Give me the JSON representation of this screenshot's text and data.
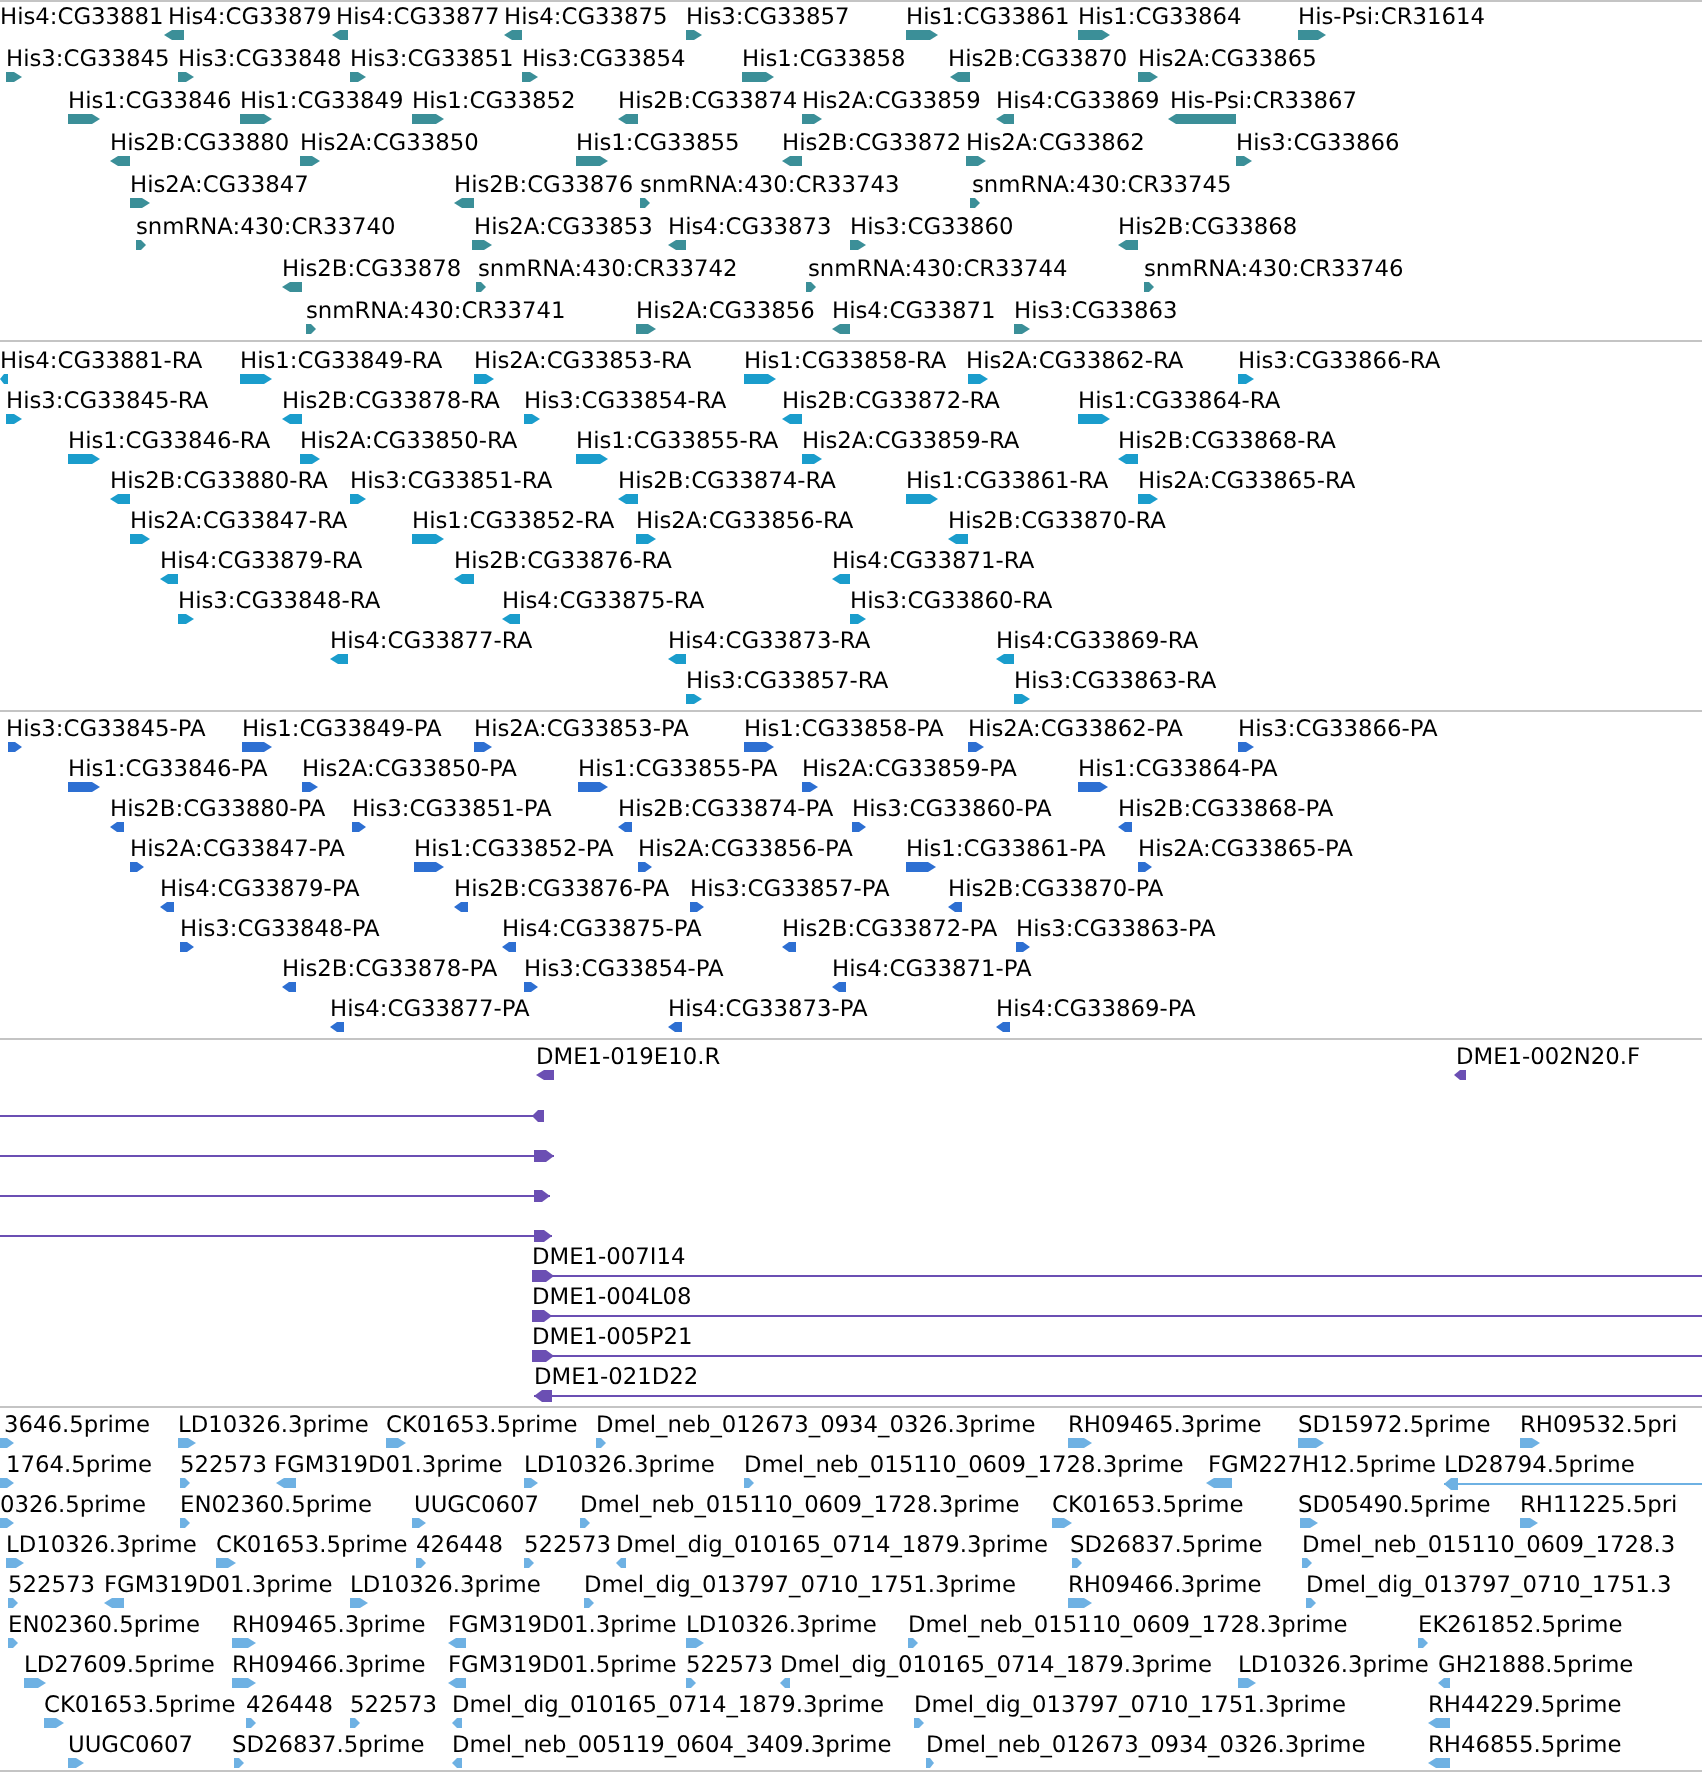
{
  "tracks": [
    {
      "color": "#3b8f98",
      "features": [
        {
          "label": "His4:CG33881"
        },
        {
          "label": "His4:CG33879",
          "reverse": true
        },
        {
          "label": "His4:CG33877",
          "reverse": true
        },
        {
          "label": "His4:CG33875",
          "reverse": true
        },
        {
          "label": "His3:CG33857",
          "reverse": false
        },
        {
          "label": "His1:CG33861",
          "reverse": false
        },
        {
          "label": "His1:CG33864",
          "reverse": false
        },
        {
          "label": "His-Psi:CR31614",
          "reverse": false
        },
        {
          "label": "His3:CG33845",
          "reverse": false
        },
        {
          "label": "His3:CG33848",
          "reverse": false
        },
        {
          "label": "His3:CG33851",
          "reverse": false
        },
        {
          "label": "His3:CG33854",
          "reverse": false
        },
        {
          "label": "His1:CG33858",
          "reverse": false
        },
        {
          "label": "His2B:CG33870",
          "reverse": true
        },
        {
          "label": "His2A:CG33865",
          "reverse": false
        },
        {
          "label": "His1:CG33846",
          "reverse": false
        },
        {
          "label": "His1:CG33849",
          "reverse": false
        },
        {
          "label": "His1:CG33852",
          "reverse": false
        },
        {
          "label": "His2B:CG33874",
          "reverse": true
        },
        {
          "label": "His2A:CG33859",
          "reverse": false
        },
        {
          "label": "His4:CG33869",
          "reverse": true
        },
        {
          "label": "His-Psi:CR33867",
          "reverse": true
        },
        {
          "label": "His2B:CG33880",
          "reverse": true
        },
        {
          "label": "His2A:CG33850",
          "reverse": false
        },
        {
          "label": "His1:CG33855",
          "reverse": false
        },
        {
          "label": "His2B:CG33872",
          "reverse": true
        },
        {
          "label": "His2A:CG33862",
          "reverse": false
        },
        {
          "label": "His3:CG33866",
          "reverse": false
        },
        {
          "label": "His2A:CG33847",
          "reverse": false
        },
        {
          "label": "His2B:CG33876",
          "reverse": true
        },
        {
          "label": "snmRNA:430:CR33743",
          "reverse": false
        },
        {
          "label": "snmRNA:430:CR33745",
          "reverse": false
        },
        {
          "label": "snmRNA:430:CR33740",
          "reverse": false
        },
        {
          "label": "His2A:CG33853",
          "reverse": false
        },
        {
          "label": "His4:CG33873",
          "reverse": true
        },
        {
          "label": "His3:CG33860",
          "reverse": false
        },
        {
          "label": "His2B:CG33868",
          "reverse": true
        },
        {
          "label": "His2B:CG33878",
          "reverse": true
        },
        {
          "label": "snmRNA:430:CR33742",
          "reverse": false
        },
        {
          "label": "snmRNA:430:CR33744",
          "reverse": false
        },
        {
          "label": "snmRNA:430:CR33746",
          "reverse": false
        },
        {
          "label": "snmRNA:430:CR33741",
          "reverse": false
        },
        {
          "label": "His2A:CG33856",
          "reverse": false
        },
        {
          "label": "His4:CG33871",
          "reverse": true
        },
        {
          "label": "His3:CG33863",
          "reverse": false
        }
      ]
    },
    {
      "color": "#1a9dcc",
      "features": [
        {
          "label": "His4:CG33881-RA",
          "reverse": true
        },
        {
          "label": "His1:CG33849-RA",
          "reverse": false
        },
        {
          "label": "His2A:CG33853-RA",
          "reverse": false
        },
        {
          "label": "His1:CG33858-RA",
          "reverse": false
        },
        {
          "label": "His2A:CG33862-RA",
          "reverse": false
        },
        {
          "label": "His3:CG33866-RA",
          "reverse": false
        },
        {
          "label": "His3:CG33845-RA",
          "reverse": false
        },
        {
          "label": "His2B:CG33878-RA",
          "reverse": true
        },
        {
          "label": "His3:CG33854-RA",
          "reverse": false
        },
        {
          "label": "His2B:CG33872-RA",
          "reverse": true
        },
        {
          "label": "His1:CG33864-RA",
          "reverse": false
        },
        {
          "label": "His1:CG33846-RA",
          "reverse": false
        },
        {
          "label": "His2A:CG33850-RA",
          "reverse": false
        },
        {
          "label": "His1:CG33855-RA",
          "reverse": false
        },
        {
          "label": "His2A:CG33859-RA",
          "reverse": false
        },
        {
          "label": "His2B:CG33868-RA",
          "reverse": true
        },
        {
          "label": "His2B:CG33880-RA",
          "reverse": true
        },
        {
          "label": "His3:CG33851-RA",
          "reverse": false
        },
        {
          "label": "His2B:CG33874-RA",
          "reverse": true
        },
        {
          "label": "His1:CG33861-RA",
          "reverse": false
        },
        {
          "label": "His2A:CG33865-RA",
          "reverse": false
        },
        {
          "label": "His2A:CG33847-RA",
          "reverse": false
        },
        {
          "label": "His1:CG33852-RA",
          "reverse": false
        },
        {
          "label": "His2A:CG33856-RA",
          "reverse": false
        },
        {
          "label": "His2B:CG33870-RA",
          "reverse": true
        },
        {
          "label": "His4:CG33879-RA",
          "reverse": true
        },
        {
          "label": "His2B:CG33876-RA",
          "reverse": true
        },
        {
          "label": "His4:CG33871-RA",
          "reverse": true
        },
        {
          "label": "His3:CG33848-RA",
          "reverse": false
        },
        {
          "label": "His4:CG33875-RA",
          "reverse": true
        },
        {
          "label": "His3:CG33860-RA",
          "reverse": false
        },
        {
          "label": "His4:CG33877-RA",
          "reverse": true
        },
        {
          "label": "His4:CG33873-RA",
          "reverse": true
        },
        {
          "label": "His4:CG33869-RA",
          "reverse": true
        },
        {
          "label": "His3:CG33857-RA",
          "reverse": false
        },
        {
          "label": "His3:CG33863-RA",
          "reverse": false
        }
      ]
    },
    {
      "color": "#2d6fd2",
      "features": [
        {
          "label": "His3:CG33845-PA",
          "reverse": false
        },
        {
          "label": "His1:CG33849-PA",
          "reverse": false
        },
        {
          "label": "His2A:CG33853-PA",
          "reverse": false
        },
        {
          "label": "His1:CG33858-PA",
          "reverse": false
        },
        {
          "label": "His2A:CG33862-PA",
          "reverse": false
        },
        {
          "label": "His3:CG33866-PA",
          "reverse": false
        },
        {
          "label": "His1:CG33846-PA",
          "reverse": false
        },
        {
          "label": "His2A:CG33850-PA",
          "reverse": false
        },
        {
          "label": "His1:CG33855-PA",
          "reverse": false
        },
        {
          "label": "His2A:CG33859-PA",
          "reverse": false
        },
        {
          "label": "His1:CG33864-PA",
          "reverse": false
        },
        {
          "label": "His2B:CG33880-PA",
          "reverse": true
        },
        {
          "label": "His3:CG33851-PA",
          "reverse": false
        },
        {
          "label": "His2B:CG33874-PA",
          "reverse": true
        },
        {
          "label": "His3:CG33860-PA",
          "reverse": false
        },
        {
          "label": "His2B:CG33868-PA",
          "reverse": true
        },
        {
          "label": "His2A:CG33847-PA",
          "reverse": false
        },
        {
          "label": "His1:CG33852-PA",
          "reverse": false
        },
        {
          "label": "His2A:CG33856-PA",
          "reverse": false
        },
        {
          "label": "His1:CG33861-PA",
          "reverse": false
        },
        {
          "label": "His2A:CG33865-PA",
          "reverse": false
        },
        {
          "label": "His4:CG33879-PA",
          "reverse": true
        },
        {
          "label": "His2B:CG33876-PA",
          "reverse": true
        },
        {
          "label": "His3:CG33857-PA",
          "reverse": false
        },
        {
          "label": "His2B:CG33870-PA",
          "reverse": true
        },
        {
          "label": "His3:CG33848-PA",
          "reverse": false
        },
        {
          "label": "His4:CG33875-PA",
          "reverse": true
        },
        {
          "label": "His2B:CG33872-PA",
          "reverse": true
        },
        {
          "label": "His3:CG33863-PA",
          "reverse": false
        },
        {
          "label": "His2B:CG33878-PA",
          "reverse": true
        },
        {
          "label": "His3:CG33854-PA",
          "reverse": false
        },
        {
          "label": "His4:CG33871-PA",
          "reverse": true
        },
        {
          "label": "His4:CG33877-PA",
          "reverse": true
        },
        {
          "label": "His4:CG33873-PA",
          "reverse": true
        },
        {
          "label": "His4:CG33869-PA",
          "reverse": true
        }
      ]
    },
    {
      "color": "#6b4fb3",
      "features": [
        {
          "label": "DME1-019E10.R",
          "reverse": true
        },
        {
          "label": "DME1-002N20.F",
          "reverse": true
        },
        {
          "reverse": true
        },
        {
          "reverse": false
        },
        {
          "reverse": false
        },
        {
          "reverse": false
        },
        {
          "label": "DME1-007I14",
          "reverse": false
        },
        {
          "label": "DME1-004L08",
          "reverse": false
        },
        {
          "label": "DME1-005P21",
          "reverse": false
        },
        {
          "label": "DME1-021D22",
          "reverse": true
        }
      ]
    },
    {
      "color": "#6eb1e3",
      "features": [
        {
          "label": "3646.5prime",
          "reverse": false
        },
        {
          "label": "LD10326.3prime",
          "reverse": false
        },
        {
          "label": "CK01653.5prime",
          "reverse": false
        },
        {
          "label": "Dmel_neb_012673_0934_0326.3prime",
          "reverse": false
        },
        {
          "label": "RH09465.3prime",
          "reverse": false
        },
        {
          "label": "SD15972.5prime",
          "reverse": false
        },
        {
          "label": "RH09532.5pri",
          "reverse": false
        },
        {
          "label": "1764.5prime",
          "reverse": false
        },
        {
          "label": "522573",
          "reverse": false
        },
        {
          "label": "FGM319D01.3prime",
          "reverse": true
        },
        {
          "label": "LD10326.3prime",
          "reverse": false
        },
        {
          "label": "Dmel_neb_015110_0609_1728.3prime",
          "reverse": false
        },
        {
          "label": "FGM227H12.5prime",
          "reverse": true
        },
        {
          "label": "LD28794.5prime",
          "reverse": true
        },
        {
          "label": "0326.5prime",
          "reverse": false
        },
        {
          "label": "EN02360.5prime",
          "reverse": false
        },
        {
          "label": "UUGC0607",
          "reverse": false
        },
        {
          "label": "Dmel_neb_015110_0609_1728.3prime",
          "reverse": false
        },
        {
          "label": "CK01653.5prime",
          "reverse": false
        },
        {
          "label": "SD05490.5prime",
          "reverse": false
        },
        {
          "label": "RH11225.5pri",
          "reverse": false
        },
        {
          "label": "LD10326.3prime",
          "reverse": false
        },
        {
          "label": "CK01653.5prime",
          "reverse": false
        },
        {
          "label": "426448",
          "reverse": false
        },
        {
          "label": "522573",
          "reverse": false
        },
        {
          "label": "Dmel_dig_010165_0714_1879.3prime",
          "reverse": true
        },
        {
          "label": "SD26837.5prime",
          "reverse": false
        },
        {
          "label": "Dmel_neb_015110_0609_1728.3",
          "reverse": false
        },
        {
          "label": "522573",
          "reverse": false
        },
        {
          "label": "FGM319D01.3prime",
          "reverse": true
        },
        {
          "label": "LD10326.3prime",
          "reverse": false
        },
        {
          "label": "Dmel_dig_013797_0710_1751.3prime",
          "reverse": false
        },
        {
          "label": "RH09466.3prime",
          "reverse": false
        },
        {
          "label": "Dmel_dig_013797_0710_1751.3",
          "reverse": false
        },
        {
          "label": "EN02360.5prime",
          "reverse": false
        },
        {
          "label": "RH09465.3prime",
          "reverse": false
        },
        {
          "label": "FGM319D01.3prime",
          "reverse": true
        },
        {
          "label": "LD10326.3prime",
          "reverse": false
        },
        {
          "label": "Dmel_neb_015110_0609_1728.3prime",
          "reverse": false
        },
        {
          "label": "EK261852.5prime",
          "reverse": false
        },
        {
          "label": "LD27609.5prime",
          "reverse": false
        },
        {
          "label": "RH09466.3prime",
          "reverse": false
        },
        {
          "label": "FGM319D01.5prime",
          "reverse": true
        },
        {
          "label": "522573",
          "reverse": false
        },
        {
          "label": "Dmel_dig_010165_0714_1879.3prime",
          "reverse": true
        },
        {
          "label": "LD10326.3prime",
          "reverse": false
        },
        {
          "label": "GH21888.5prime",
          "reverse": true
        },
        {
          "label": "CK01653.5prime",
          "reverse": false
        },
        {
          "label": "426448",
          "reverse": false
        },
        {
          "label": "522573",
          "reverse": false
        },
        {
          "label": "Dmel_dig_010165_0714_1879.3prime",
          "reverse": true
        },
        {
          "label": "Dmel_dig_013797_0710_1751.3prime",
          "reverse": false
        },
        {
          "label": "RH44229.5prime",
          "reverse": true
        },
        {
          "label": "UUGC0607",
          "reverse": false
        },
        {
          "label": "SD26837.5prime",
          "reverse": false
        },
        {
          "label": "Dmel_neb_005119_0604_3409.3prime",
          "reverse": true
        },
        {
          "label": "Dmel_neb_012673_0934_0326.3prime",
          "reverse": false
        },
        {
          "label": "RH46855.5prime",
          "reverse": true
        }
      ]
    }
  ]
}
